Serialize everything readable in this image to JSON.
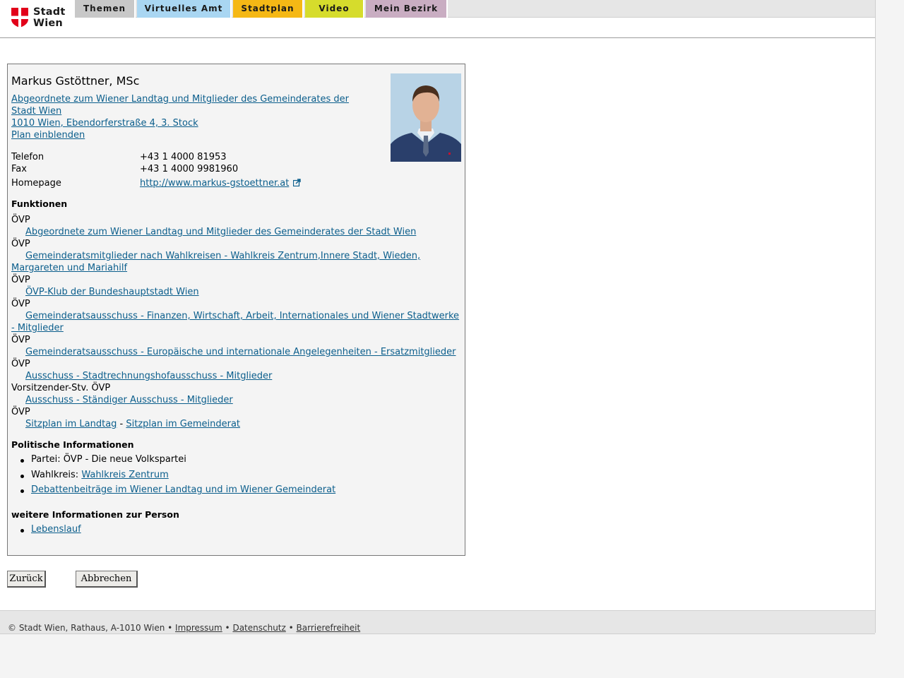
{
  "header": {
    "logo_text_line1": "Stadt",
    "logo_text_line2": "Wien",
    "nav": [
      {
        "label": "Themen",
        "color": "#c8c8c8"
      },
      {
        "label": "Virtuelles Amt",
        "color": "#a9d6f2"
      },
      {
        "label": "Stadtplan",
        "color": "#f5b815"
      },
      {
        "label": "Video",
        "color": "#d6dc2c"
      },
      {
        "label": "Mein Bezirk",
        "color": "#c9adc2"
      }
    ]
  },
  "person": {
    "name": "Markus Gstöttner, MSc",
    "org_link_line1": "Abgeordnete zum Wiener Landtag und Mitglieder des Gemeinderates der",
    "org_link_line2": "Stadt Wien ",
    "address": "1010 Wien, Ebendorferstraße 4, 3. Stock",
    "plan_link": "Plan einblenden",
    "contact": [
      {
        "label": "Telefon",
        "value": "+43 1 4000 81953"
      },
      {
        "label": "Fax",
        "value": "+43 1 4000 9981960"
      },
      {
        "label": "Homepage",
        "value": "http://www.markus-gstoettner.at"
      }
    ]
  },
  "funktionen": {
    "heading": "Funktionen",
    "items": [
      {
        "role": "ÖVP",
        "line1": "Abgeordnete zum Wiener Landtag und Mitglieder des Gemeinderates der Stadt Wien",
        "line2": ""
      },
      {
        "role": "ÖVP",
        "line1": "Gemeinderatsmitglieder nach Wahlkreisen - Wahlkreis Zentrum,Innere Stadt, Wieden,",
        "line2": "Margareten und Mariahilf"
      },
      {
        "role": "ÖVP",
        "line1": "ÖVP-Klub der Bundeshauptstadt Wien",
        "line2": ""
      },
      {
        "role": "ÖVP",
        "line1": "Gemeinderatsausschuss - Finanzen, Wirtschaft, Arbeit, Internationales und Wiener Stadtwerke",
        "line2": "- Mitglieder"
      },
      {
        "role": "ÖVP",
        "line1": "Gemeinderatsausschuss - Europäische und internationale Angelegenheiten - Ersatzmitglieder",
        "line2": ""
      },
      {
        "role": "ÖVP",
        "line1": "Ausschuss - Stadtrechnungshofausschuss - Mitglieder",
        "line2": ""
      },
      {
        "role": "Vorsitzender-Stv. ÖVP",
        "line1": "Ausschuss - Ständiger Ausschuss - Mitglieder",
        "line2": ""
      }
    ],
    "seat_role": "ÖVP",
    "seat_link_landtag": "Sitzplan im Landtag",
    "seat_separator": " - ",
    "seat_link_gemeinderat": "Sitzplan im Gemeinderat"
  },
  "politisch": {
    "heading": "Politische Informationen",
    "partei_prefix": "Partei: ",
    "partei": "ÖVP - Die neue Volkspartei",
    "wahlkreis_prefix": "Wahlkreis: ",
    "wahlkreis": "Wahlkreis Zentrum",
    "debatten": "Debattenbeiträge im Wiener Landtag und im Wiener Gemeinderat"
  },
  "weitere": {
    "heading": "weitere Informationen zur Person",
    "lebenslauf": "Lebenslauf"
  },
  "buttons": {
    "back": "Zurück",
    "cancel": "Abbrechen"
  },
  "footer": {
    "copyright": "© Stadt Wien, Rathaus, A-1010 Wien",
    "sep": " • ",
    "impressum": "Impressum",
    "datenschutz": "Datenschutz",
    "barrierefreiheit": "Barrierefreiheit"
  }
}
